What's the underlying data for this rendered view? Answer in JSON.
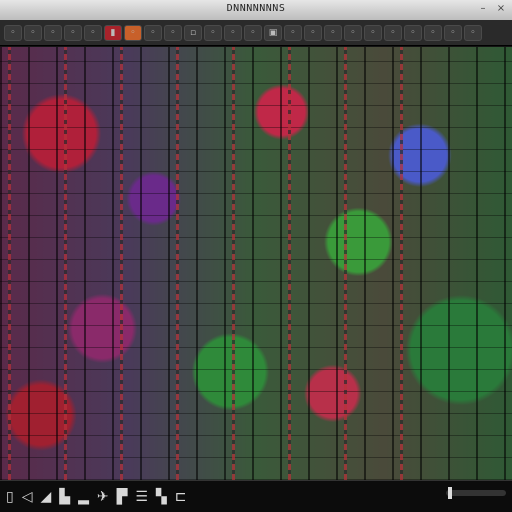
{
  "titlebar": {
    "title": "DNNNNNNNS",
    "min_icon": "minimize-icon",
    "close_icon": "close-icon"
  },
  "toolbar": {
    "buttons": [
      {
        "icon": "o-icon",
        "glyph": "◦"
      },
      {
        "icon": "o-icon",
        "glyph": "◦"
      },
      {
        "icon": "o-icon",
        "glyph": "◦"
      },
      {
        "icon": "o-icon",
        "glyph": "◦"
      },
      {
        "icon": "o-icon",
        "glyph": "◦"
      },
      {
        "icon": "flag-icon",
        "glyph": "▮"
      },
      {
        "icon": "o-icon",
        "glyph": "◦"
      },
      {
        "icon": "o-icon",
        "glyph": "◦"
      },
      {
        "icon": "o-icon",
        "glyph": "◦"
      },
      {
        "icon": "square-icon",
        "glyph": "▫"
      },
      {
        "icon": "o-icon",
        "glyph": "◦"
      },
      {
        "icon": "o-icon",
        "glyph": "◦"
      },
      {
        "icon": "o-icon",
        "glyph": "◦"
      },
      {
        "icon": "image-icon",
        "glyph": "▣"
      },
      {
        "icon": "o-icon",
        "glyph": "◦"
      },
      {
        "icon": "o-icon",
        "glyph": "◦"
      },
      {
        "icon": "o-icon",
        "glyph": "◦"
      },
      {
        "icon": "o-icon",
        "glyph": "◦"
      },
      {
        "icon": "o-icon",
        "glyph": "◦"
      },
      {
        "icon": "o-icon",
        "glyph": "◦"
      },
      {
        "icon": "o-icon",
        "glyph": "◦"
      },
      {
        "icon": "o-icon",
        "glyph": "◦"
      },
      {
        "icon": "o-icon",
        "glyph": "◦"
      },
      {
        "icon": "o-icon",
        "glyph": "◦"
      }
    ]
  },
  "statusbar": {
    "icons": [
      {
        "name": "frame-icon",
        "glyph": "▯"
      },
      {
        "name": "back-icon",
        "glyph": "◁"
      },
      {
        "name": "marker-icon",
        "glyph": "◢"
      },
      {
        "name": "doc-icon",
        "glyph": "▙"
      },
      {
        "name": "slot-icon",
        "glyph": "▂"
      },
      {
        "name": "plane-icon",
        "glyph": "✈"
      },
      {
        "name": "card-icon",
        "glyph": "▛"
      },
      {
        "name": "list-icon",
        "glyph": "☰"
      },
      {
        "name": "page-icon",
        "glyph": "▚"
      },
      {
        "name": "end-icon",
        "glyph": "⊏"
      }
    ]
  },
  "colors": {
    "accent_red": "#a8232b",
    "accent_orange": "#c8602a",
    "bar_bg": "#0c0c0c"
  }
}
